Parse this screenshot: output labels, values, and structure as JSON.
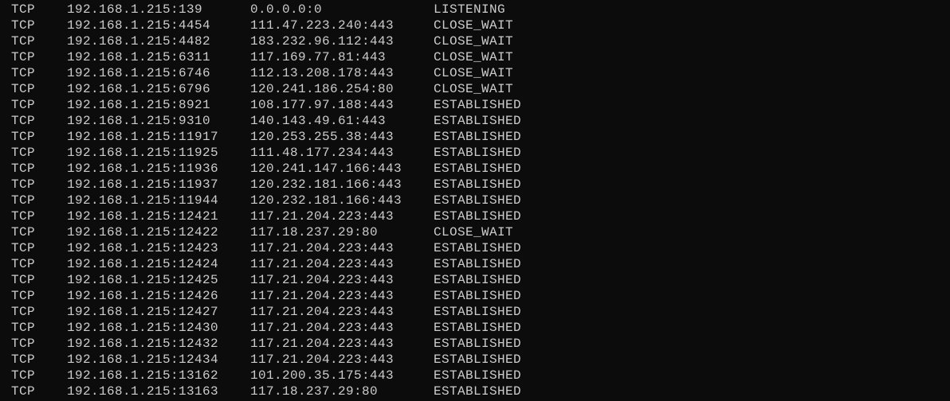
{
  "terminal": {
    "colors": {
      "background": "#0c0c0c",
      "text": "#cccccc"
    },
    "rows": [
      {
        "proto": "TCP",
        "local": "192.168.1.215:139",
        "foreign": "0.0.0.0:0",
        "state": "LISTENING"
      },
      {
        "proto": "TCP",
        "local": "192.168.1.215:4454",
        "foreign": "111.47.223.240:443",
        "state": "CLOSE_WAIT"
      },
      {
        "proto": "TCP",
        "local": "192.168.1.215:4482",
        "foreign": "183.232.96.112:443",
        "state": "CLOSE_WAIT"
      },
      {
        "proto": "TCP",
        "local": "192.168.1.215:6311",
        "foreign": "117.169.77.81:443",
        "state": "CLOSE_WAIT"
      },
      {
        "proto": "TCP",
        "local": "192.168.1.215:6746",
        "foreign": "112.13.208.178:443",
        "state": "CLOSE_WAIT"
      },
      {
        "proto": "TCP",
        "local": "192.168.1.215:6796",
        "foreign": "120.241.186.254:80",
        "state": "CLOSE_WAIT"
      },
      {
        "proto": "TCP",
        "local": "192.168.1.215:8921",
        "foreign": "108.177.97.188:443",
        "state": "ESTABLISHED"
      },
      {
        "proto": "TCP",
        "local": "192.168.1.215:9310",
        "foreign": "140.143.49.61:443",
        "state": "ESTABLISHED"
      },
      {
        "proto": "TCP",
        "local": "192.168.1.215:11917",
        "foreign": "120.253.255.38:443",
        "state": "ESTABLISHED"
      },
      {
        "proto": "TCP",
        "local": "192.168.1.215:11925",
        "foreign": "111.48.177.234:443",
        "state": "ESTABLISHED"
      },
      {
        "proto": "TCP",
        "local": "192.168.1.215:11936",
        "foreign": "120.241.147.166:443",
        "state": "ESTABLISHED"
      },
      {
        "proto": "TCP",
        "local": "192.168.1.215:11937",
        "foreign": "120.232.181.166:443",
        "state": "ESTABLISHED"
      },
      {
        "proto": "TCP",
        "local": "192.168.1.215:11944",
        "foreign": "120.232.181.166:443",
        "state": "ESTABLISHED"
      },
      {
        "proto": "TCP",
        "local": "192.168.1.215:12421",
        "foreign": "117.21.204.223:443",
        "state": "ESTABLISHED"
      },
      {
        "proto": "TCP",
        "local": "192.168.1.215:12422",
        "foreign": "117.18.237.29:80",
        "state": "CLOSE_WAIT"
      },
      {
        "proto": "TCP",
        "local": "192.168.1.215:12423",
        "foreign": "117.21.204.223:443",
        "state": "ESTABLISHED"
      },
      {
        "proto": "TCP",
        "local": "192.168.1.215:12424",
        "foreign": "117.21.204.223:443",
        "state": "ESTABLISHED"
      },
      {
        "proto": "TCP",
        "local": "192.168.1.215:12425",
        "foreign": "117.21.204.223:443",
        "state": "ESTABLISHED"
      },
      {
        "proto": "TCP",
        "local": "192.168.1.215:12426",
        "foreign": "117.21.204.223:443",
        "state": "ESTABLISHED"
      },
      {
        "proto": "TCP",
        "local": "192.168.1.215:12427",
        "foreign": "117.21.204.223:443",
        "state": "ESTABLISHED"
      },
      {
        "proto": "TCP",
        "local": "192.168.1.215:12430",
        "foreign": "117.21.204.223:443",
        "state": "ESTABLISHED"
      },
      {
        "proto": "TCP",
        "local": "192.168.1.215:12432",
        "foreign": "117.21.204.223:443",
        "state": "ESTABLISHED"
      },
      {
        "proto": "TCP",
        "local": "192.168.1.215:12434",
        "foreign": "117.21.204.223:443",
        "state": "ESTABLISHED"
      },
      {
        "proto": "TCP",
        "local": "192.168.1.215:13162",
        "foreign": "101.200.35.175:443",
        "state": "ESTABLISHED"
      },
      {
        "proto": "TCP",
        "local": "192.168.1.215:13163",
        "foreign": "117.18.237.29:80",
        "state": "ESTABLISHED"
      }
    ]
  }
}
